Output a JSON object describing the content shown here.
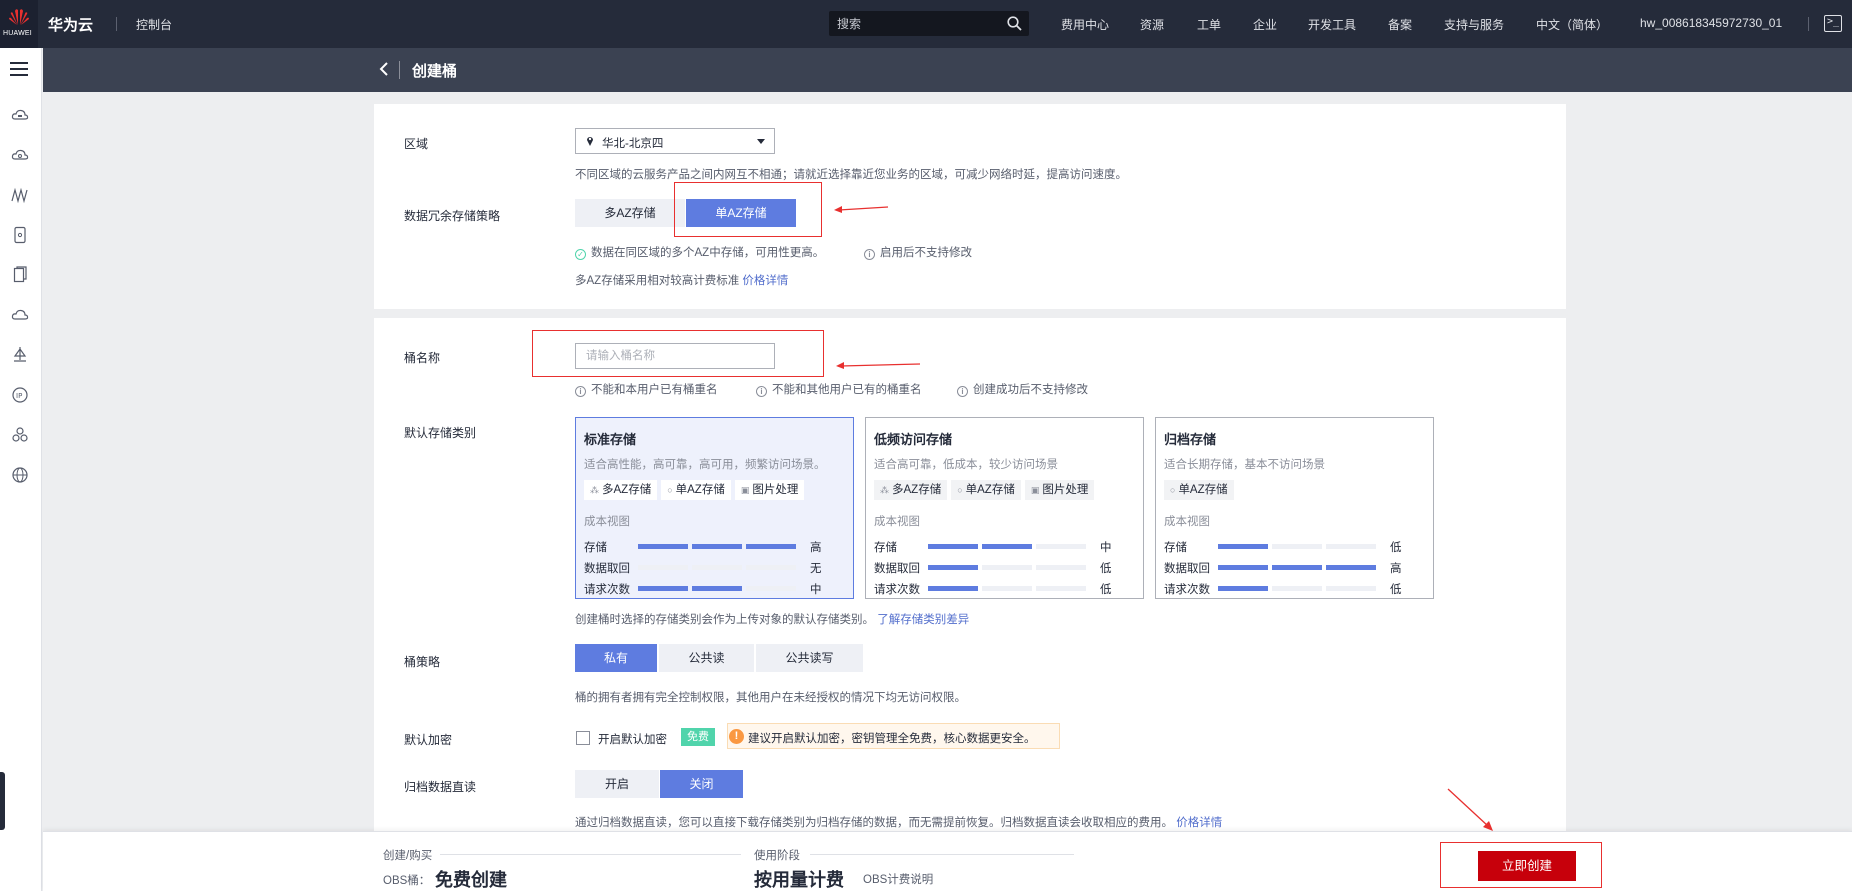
{
  "header": {
    "logo_text": "HUAWEI",
    "brand": "华为云",
    "console": "控制台",
    "search_placeholder": "搜索",
    "nav": [
      "费用中心",
      "资源",
      "工单",
      "企业",
      "开发工具",
      "备案",
      "支持与服务",
      "中文（简体）",
      "hw_008618345972730_01"
    ],
    "terminal_icon": ">_"
  },
  "rail": {
    "icons": [
      "cloud-server-icon",
      "cloud-database-icon",
      "network-icon",
      "storage-icon",
      "document-icon",
      "cloud-icon",
      "deploy-icon",
      "ip-icon",
      "cluster-icon",
      "globe-icon"
    ]
  },
  "page": {
    "title": "创建桶"
  },
  "region": {
    "label": "区域",
    "value": "华北-北京四",
    "hint": "不同区域的云服务产品之间内网互不相通；请就近选择靠近您业务的区域，可减少网络时延，提高访问速度。"
  },
  "redundancy": {
    "label": "数据冗余存储策略",
    "options": [
      "多AZ存储",
      "单AZ存储"
    ],
    "selected": "单AZ存储",
    "hint_ok": "数据在同区域的多个AZ中存储，可用性更高。",
    "hint_info": "启用后不支持修改",
    "price_hint": "多AZ存储采用相对较高计费标准",
    "price_link": "价格详情"
  },
  "bucket_name": {
    "label": "桶名称",
    "placeholder": "请输入桶名称",
    "rules": [
      "不能和本用户已有桶重名",
      "不能和其他用户已有的桶重名",
      "创建成功后不支持修改"
    ]
  },
  "storage_class": {
    "label": "默认存储类别",
    "cost_view": "成本视图",
    "rows": [
      "存储",
      "数据取回",
      "请求次数"
    ],
    "cards": [
      {
        "title": "标准存储",
        "desc": "适合高性能，高可靠，高可用，频繁访问场景。",
        "tags": [
          "多AZ存储",
          "单AZ存储",
          "图片处理"
        ],
        "levels": [
          3,
          0,
          2
        ],
        "values": [
          "高",
          "无",
          "中"
        ],
        "selected": true
      },
      {
        "title": "低频访问存储",
        "desc": "适合高可靠，低成本，较少访问场景",
        "tags": [
          "多AZ存储",
          "单AZ存储",
          "图片处理"
        ],
        "levels": [
          2,
          1,
          1
        ],
        "values": [
          "中",
          "低",
          "低"
        ],
        "selected": false
      },
      {
        "title": "归档存储",
        "desc": "适合长期存储，基本不访问场景",
        "tags": [
          "单AZ存储"
        ],
        "levels": [
          1,
          3,
          1
        ],
        "values": [
          "低",
          "高",
          "低"
        ],
        "selected": false
      }
    ],
    "hint": "创建桶时选择的存储类别会作为上传对象的默认存储类别。",
    "hint_link": "了解存储类别差异"
  },
  "policy": {
    "label": "桶策略",
    "options": [
      "私有",
      "公共读",
      "公共读写"
    ],
    "selected": "私有",
    "hint": "桶的拥有者拥有完全控制权限，其他用户在未经授权的情况下均无访问权限。"
  },
  "encryption": {
    "label": "默认加密",
    "checkbox_label": "开启默认加密",
    "checked": false,
    "badge": "免费",
    "warning": "建议开启默认加密，密钥管理全免费，核心数据更安全。"
  },
  "archive": {
    "label": "归档数据直读",
    "options": [
      "开启",
      "关闭"
    ],
    "selected": "关闭",
    "hint": "通过归档数据直读，您可以直接下载存储类别为归档存储的数据，而无需提前恢复。归档数据直读会收取相应的费用。",
    "hint_link": "价格详情"
  },
  "footer": {
    "stage1": "创建/购买",
    "obs_label": "OBS桶：",
    "obs_value": "免费创建",
    "stage2": "使用阶段",
    "usage_value": "按用量计费",
    "obs_link": "OBS计费说明",
    "create_button": "立即创建"
  },
  "colors": {
    "primary": "#5e7ce0",
    "create": "#c7000b",
    "annotation": "#e8302f",
    "topbar": "#252b3a"
  }
}
